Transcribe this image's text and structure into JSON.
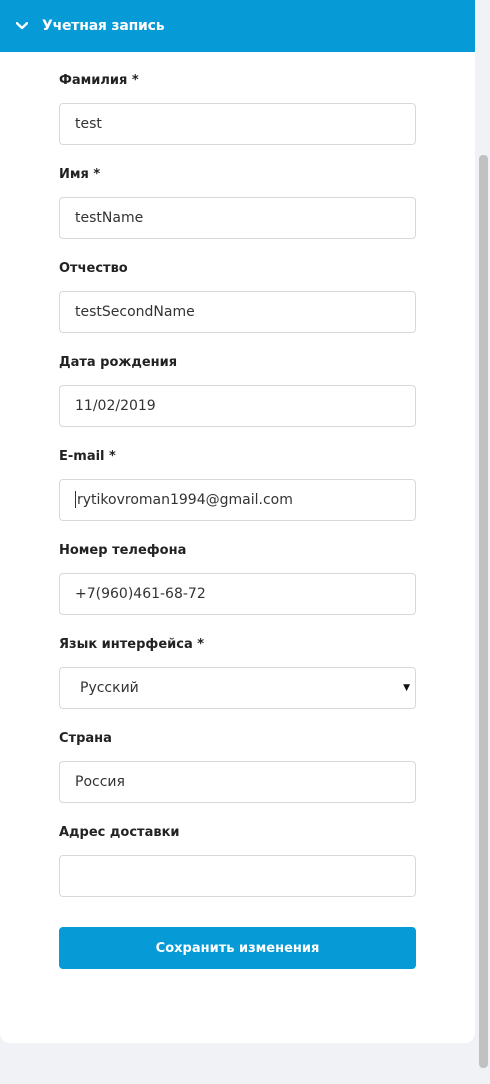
{
  "header": {
    "title": "Учетная запись",
    "toggle_icon": "chevron-down-icon"
  },
  "fields": [
    {
      "label": "Фамилия *",
      "value": "test"
    },
    {
      "label": "Имя *",
      "value": "testName"
    },
    {
      "label": "Отчество",
      "value": "testSecondName"
    },
    {
      "label": "Дата рождения",
      "value": "11/02/2019"
    },
    {
      "label": "E-mail *",
      "value": "rytikovroman1994@gmail.com"
    },
    {
      "label": "Номер телефона",
      "value": "+7(960)461-68-72"
    },
    {
      "label": "Язык интерфейса *",
      "value": "Русский",
      "type": "select"
    },
    {
      "label": "Страна",
      "value": "Россия"
    },
    {
      "label": "Адрес доставки",
      "value": ""
    }
  ],
  "save_button": {
    "label": "Сохранить изменения"
  },
  "colors": {
    "accent": "#069bd7",
    "background": "#f1f2f5"
  }
}
